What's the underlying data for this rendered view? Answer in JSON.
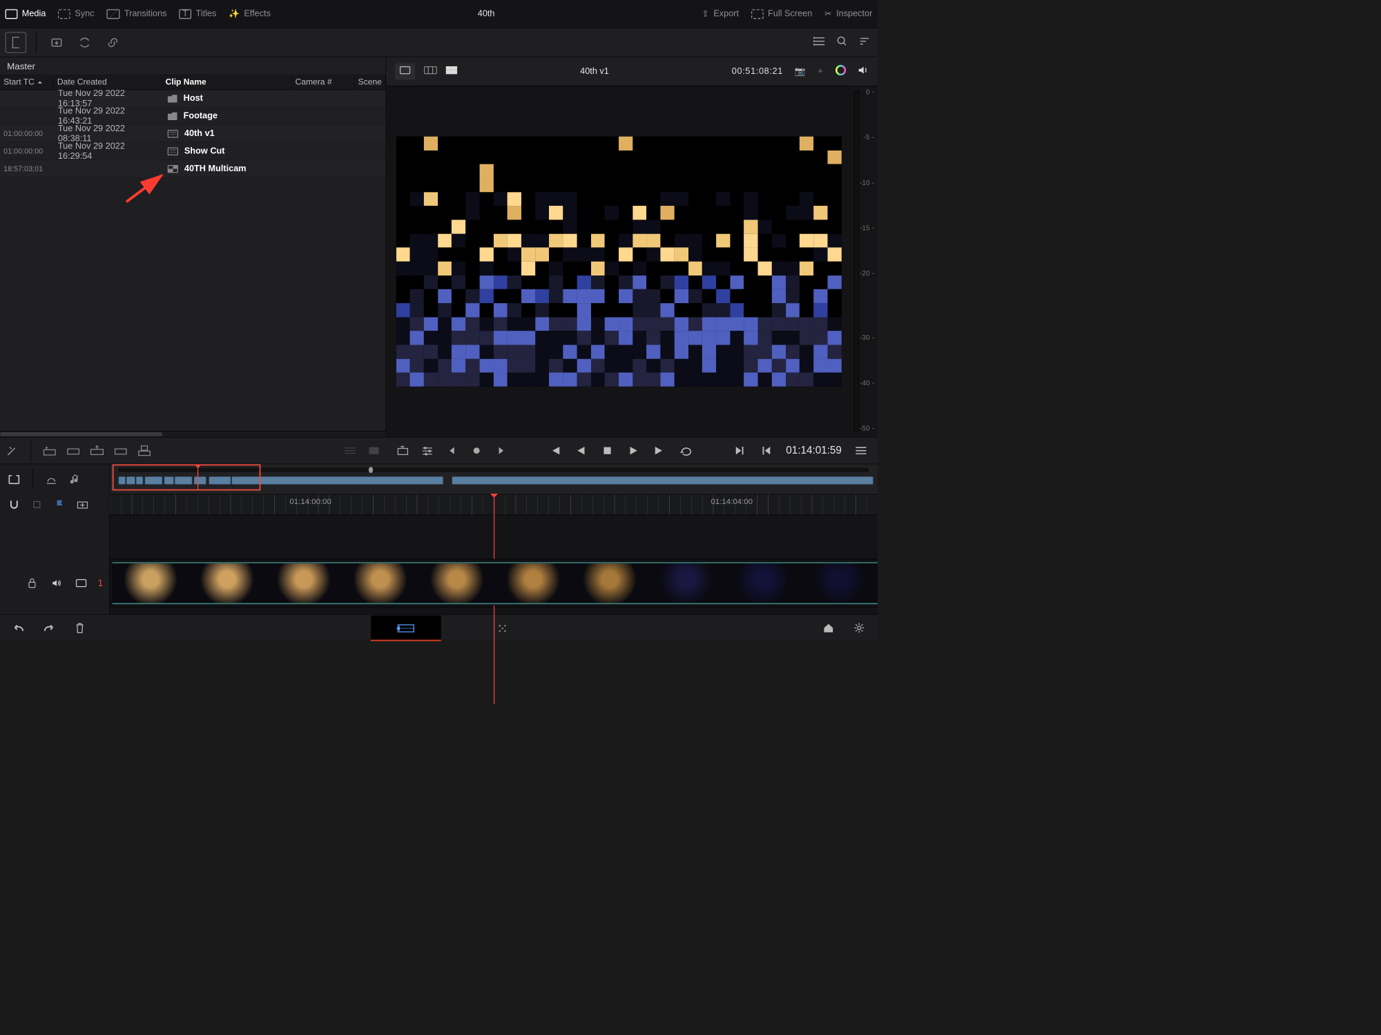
{
  "menubar": {
    "items": [
      {
        "label": "Media",
        "active": true
      },
      {
        "label": "Sync"
      },
      {
        "label": "Transitions"
      },
      {
        "label": "Titles"
      },
      {
        "label": "Effects"
      }
    ],
    "project_title": "40th",
    "right_items": [
      {
        "label": "Export"
      },
      {
        "label": "Full Screen"
      },
      {
        "label": "Inspector"
      }
    ]
  },
  "pool": {
    "bin_label": "Master",
    "columns": {
      "start_tc": "Start TC",
      "date": "Date Created",
      "clip": "Clip Name",
      "camera": "Camera #",
      "scene": "Scene"
    },
    "rows": [
      {
        "tc": "",
        "date": "Tue Nov 29 2022 16:13:57",
        "type": "folder",
        "name": "Host"
      },
      {
        "tc": "",
        "date": "Tue Nov 29 2022 16:43:21",
        "type": "folder",
        "name": "Footage"
      },
      {
        "tc": "01:00:00:00",
        "date": "Tue Nov 29 2022 08:38:11",
        "type": "timeline",
        "name": "40th v1"
      },
      {
        "tc": "01:00:00:00",
        "date": "Tue Nov 29 2022 16:29:54",
        "type": "timeline",
        "name": "Show Cut"
      },
      {
        "tc": "18:57:03;01",
        "date": "",
        "type": "multi",
        "name": "40TH  Multicam"
      }
    ]
  },
  "viewer": {
    "title": "40th v1",
    "timecode": "00:51:08:21",
    "meter_ticks": [
      "0 -",
      "",
      "-5 -",
      "",
      "-10 -",
      "",
      "-15 -",
      "",
      "-20 -",
      "",
      "",
      "-30 -",
      "",
      "-40 -",
      "",
      "-50 -"
    ]
  },
  "transport": {
    "duration": "01:14:01:59",
    "ruler_tc_a": "01:14:00:00",
    "ruler_tc_b": "01:14:04:00",
    "track_number": "1"
  }
}
